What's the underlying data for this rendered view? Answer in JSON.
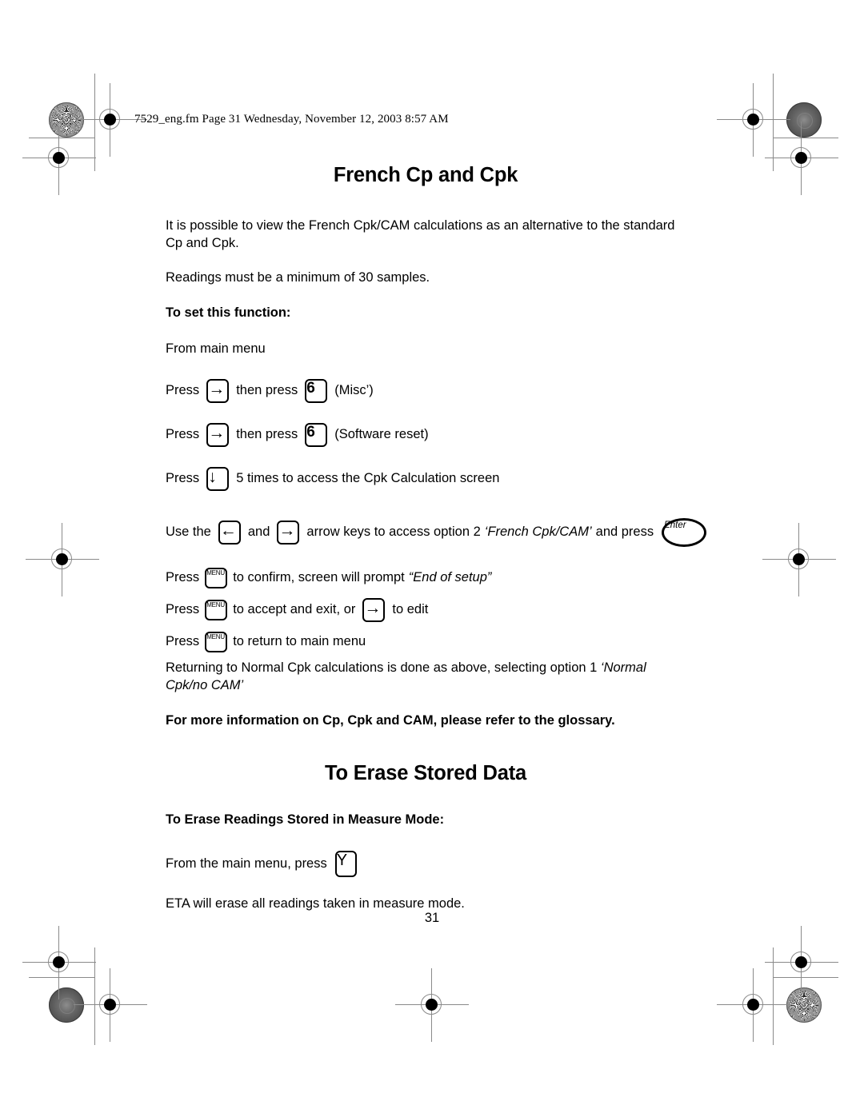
{
  "header": {
    "slug": "7529_eng.fm  Page 31  Wednesday, November 12, 2003  8:57 AM"
  },
  "sections": [
    {
      "title": "French Cp and Cpk",
      "intro": "It is possible to view the French Cpk/CAM calculations as an alternative to the standard Cp and Cpk.",
      "note": "Readings must be a minimum of 30 samples.",
      "subheading": "To set this function:",
      "from_menu": "From main menu",
      "steps": [
        {
          "press_label": "Press",
          "key1": "right-arrow",
          "key1_glyph": "→",
          "mid": "then press",
          "key2": "6",
          "key2_glyph": "6",
          "tail": "(Misc’)"
        },
        {
          "press_label": "Press",
          "key1": "right-arrow",
          "key1_glyph": "→",
          "mid": "then press",
          "key2": "6",
          "key2_glyph": "6",
          "tail": "(Software reset)"
        }
      ],
      "down_step": {
        "press_label": "Press",
        "key_glyph": "↓",
        "tail": "5 times to access the Cpk Calculation screen"
      },
      "arrow_step": {
        "lead": "Use the",
        "left_glyph": "←",
        "and": "and",
        "right_glyph": "→",
        "mid": "arrow keys to access option 2",
        "option_italic": "‘French Cpk/CAM’",
        "tail": "and press",
        "enter_label": "Enter"
      },
      "menu_steps": [
        {
          "press_label": "Press",
          "menu_label": "MENU",
          "text": "to confirm, screen will prompt",
          "quote": "“End of setup”",
          "after": "",
          "extra_key_glyph": "",
          "after2": ""
        },
        {
          "press_label": "Press",
          "menu_label": "MENU",
          "text": "to accept and exit, or",
          "quote": "",
          "after": "",
          "extra_key_glyph": "→",
          "after2": "to edit"
        },
        {
          "press_label": "Press",
          "menu_label": "MENU",
          "text": "to return to main menu",
          "quote": "",
          "after": "",
          "extra_key_glyph": "",
          "after2": ""
        }
      ],
      "closing_normal": "Returning to Normal Cpk calculations is done as above, selecting option 1",
      "closing_italic": "‘Normal Cpk/no CAM’",
      "glossary_note": "For more information on Cp, Cpk and CAM, please refer to the glossary."
    },
    {
      "title": "To Erase Stored Data",
      "subheading": "To Erase Readings Stored in Measure Mode:",
      "press_line_lead": "From the main menu, press",
      "press_key": "Y",
      "result": "ETA will erase all readings taken in measure mode."
    }
  ],
  "footer": {
    "page_number": "31"
  }
}
